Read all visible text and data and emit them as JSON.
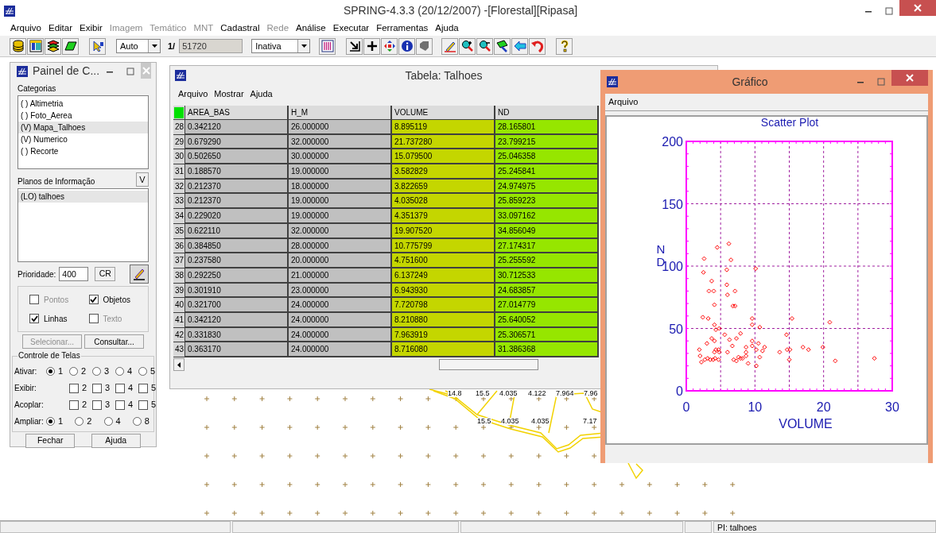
{
  "app_window": {
    "title": "SPRING-4.3.3 (20/12/2007) -[Florestal][Ripasa]"
  },
  "menu": [
    {
      "label": "Arquivo",
      "disabled": false
    },
    {
      "label": "Editar",
      "disabled": false
    },
    {
      "label": "Exibir",
      "disabled": false
    },
    {
      "label": "Imagem",
      "disabled": true
    },
    {
      "label": "Temático",
      "disabled": true
    },
    {
      "label": "MNT",
      "disabled": true
    },
    {
      "label": "Cadastral",
      "disabled": false
    },
    {
      "label": "Rede",
      "disabled": true
    },
    {
      "label": "Análise",
      "disabled": false
    },
    {
      "label": "Executar",
      "disabled": false
    },
    {
      "label": "Ferramentas",
      "disabled": false
    },
    {
      "label": "Ajuda",
      "disabled": false
    }
  ],
  "toolbar": {
    "scale_mode": "Auto",
    "scale_prefix": "1/",
    "scale": "51720",
    "display_mode": "Inativa"
  },
  "panel": {
    "title": "Painel de C...",
    "categories_label": "Categorias",
    "categories": [
      {
        "label": "( ) Altimetria",
        "selected": false
      },
      {
        "label": "( ) Foto_Aerea",
        "selected": false
      },
      {
        "label": "(V) Mapa_Talhoes",
        "selected": true
      },
      {
        "label": "(V) Numerico",
        "selected": false
      },
      {
        "label": "( ) Recorte",
        "selected": false
      }
    ],
    "planes_label": "Planos de Informação",
    "planes_button": "V",
    "planes": [
      {
        "label": "(LO) talhoes",
        "selected": true
      }
    ],
    "priority_label": "Prioridade:",
    "priority": "400",
    "cr_button": "CR",
    "draw_options": [
      {
        "label": "Pontos",
        "checked": false,
        "disabled": true
      },
      {
        "label": "Objetos",
        "checked": true,
        "disabled": false
      },
      {
        "label": "Linhas",
        "checked": true,
        "disabled": false
      },
      {
        "label": "Texto",
        "checked": false,
        "disabled": true
      }
    ],
    "buttons": [
      {
        "label": "Selecionar...",
        "disabled": true
      },
      {
        "label": "Consultar...",
        "disabled": false
      }
    ],
    "screens_group": "Controle de Telas",
    "screen_rows": [
      {
        "label": "Ativar:",
        "kind": "radio",
        "options": [
          {
            "label": "1",
            "selected": true
          },
          {
            "label": "2",
            "selected": false
          },
          {
            "label": "3",
            "selected": false
          },
          {
            "label": "4",
            "selected": false
          },
          {
            "label": "5",
            "selected": false
          }
        ]
      },
      {
        "label": "Exibir:",
        "kind": "checkbox",
        "options": [
          {
            "label": "2",
            "checked": false
          },
          {
            "label": "3",
            "checked": false
          },
          {
            "label": "4",
            "checked": false
          },
          {
            "label": "5",
            "checked": false
          }
        ]
      },
      {
        "label": "Acoplar:",
        "kind": "checkbox",
        "options": [
          {
            "label": "2",
            "checked": false
          },
          {
            "label": "3",
            "checked": false
          },
          {
            "label": "4",
            "checked": false
          },
          {
            "label": "5",
            "checked": false
          }
        ]
      },
      {
        "label": "Ampliar:",
        "kind": "radio",
        "options": [
          {
            "label": "1",
            "selected": true
          },
          {
            "label": "2",
            "selected": false
          },
          {
            "label": "4",
            "selected": false
          },
          {
            "label": "8",
            "selected": false
          }
        ]
      }
    ],
    "footer_buttons": [
      "Fechar",
      "Ajuda"
    ]
  },
  "table_window": {
    "title": "Tabela: Talhoes",
    "menu": [
      "Arquivo",
      "Mostrar",
      "Ajuda"
    ],
    "columns": [
      {
        "label": "AREA_BAS",
        "color": "#c0c0c0"
      },
      {
        "label": "H_M",
        "color": "#c0c0c0"
      },
      {
        "label": "VOLUME",
        "color": "#c4d600"
      },
      {
        "label": "ND",
        "color": "#96e600"
      }
    ],
    "rows": [
      {
        "number": "28",
        "cells": [
          "0.342120",
          "26.000000",
          "8.895119",
          "28.165801"
        ]
      },
      {
        "number": "29",
        "cells": [
          "0.679290",
          "32.000000",
          "21.737280",
          "23.799215"
        ]
      },
      {
        "number": "30",
        "cells": [
          "0.502650",
          "30.000000",
          "15.079500",
          "25.046358"
        ]
      },
      {
        "number": "31",
        "cells": [
          "0.188570",
          "19.000000",
          "3.582829",
          "25.245841"
        ]
      },
      {
        "number": "32",
        "cells": [
          "0.212370",
          "18.000000",
          "3.822659",
          "24.974975"
        ]
      },
      {
        "number": "33",
        "cells": [
          "0.212370",
          "19.000000",
          "4.035028",
          "25.859223"
        ]
      },
      {
        "number": "34",
        "cells": [
          "0.229020",
          "19.000000",
          "4.351379",
          "33.097162"
        ]
      },
      {
        "number": "35",
        "cells": [
          "0.622110",
          "32.000000",
          "19.907520",
          "34.856049"
        ]
      },
      {
        "number": "36",
        "cells": [
          "0.384850",
          "28.000000",
          "10.775799",
          "27.174317"
        ]
      },
      {
        "number": "37",
        "cells": [
          "0.237580",
          "20.000000",
          "4.751600",
          "25.255592"
        ]
      },
      {
        "number": "38",
        "cells": [
          "0.292250",
          "21.000000",
          "6.137249",
          "30.712533"
        ]
      },
      {
        "number": "39",
        "cells": [
          "0.301910",
          "23.000000",
          "6.943930",
          "24.683857"
        ]
      },
      {
        "number": "40",
        "cells": [
          "0.321700",
          "24.000000",
          "7.720798",
          "27.014779"
        ]
      },
      {
        "number": "41",
        "cells": [
          "0.342120",
          "24.000000",
          "8.210880",
          "25.640052"
        ]
      },
      {
        "number": "42",
        "cells": [
          "0.331830",
          "24.000000",
          "7.963919",
          "25.306571"
        ]
      },
      {
        "number": "43",
        "cells": [
          "0.363170",
          "24.000000",
          "8.716080",
          "31.386368"
        ]
      }
    ]
  },
  "chart_window": {
    "title": "Gráfico",
    "menu": [
      "Arquivo"
    ],
    "chart_data": {
      "type": "scatter",
      "title": "Scatter Plot",
      "xlabel": "VOLUME",
      "ylabel": "ND",
      "grid": true,
      "x": [
        2.6,
        2.5,
        4.5,
        6.2,
        6.5,
        5.9,
        10.1,
        3.7,
        3.3,
        4.0,
        5.9,
        6.0,
        7.1,
        4.1,
        6.8,
        7.1,
        2.4,
        3.2,
        9.6,
        15.4,
        20.9,
        4.1,
        9.6,
        10.7,
        4.8,
        4.3,
        5.6,
        7.9,
        14.6,
        3.7,
        7.3,
        3.0,
        4.1,
        6.3,
        9.6,
        10.5,
        9.6,
        6.7,
        8.7,
        11.4,
        17.0,
        19.9,
        1.9,
        4.3,
        4.7,
        10.2,
        11.1,
        14.7,
        15.1,
        17.8,
        8.7,
        4.1,
        4.8,
        6.0,
        13.6,
        2.0,
        8.7,
        10.7,
        7.6,
        2.7,
        3.1,
        3.5,
        3.9,
        4.2,
        4.7,
        6.9,
        7.3,
        7.9,
        8.2,
        15.0,
        27.4,
        2.2,
        9.0,
        10.2,
        21.7
      ],
      "series": [
        {
          "color": "#ff0000",
          "values": [
            106,
            95,
            115,
            118,
            105,
            97,
            98,
            88,
            80,
            80,
            85,
            77,
            80,
            69,
            68,
            68,
            59,
            58,
            58,
            58,
            55,
            53,
            53,
            51,
            50,
            49,
            45,
            46,
            45,
            42,
            42,
            38,
            40,
            41,
            40,
            38,
            36,
            36,
            35,
            35,
            35,
            35,
            33,
            33,
            33,
            33,
            32,
            33,
            33,
            33,
            31,
            31,
            31,
            31,
            31,
            28,
            28,
            27,
            27,
            25,
            26,
            25,
            25,
            26,
            25,
            25,
            24,
            26,
            26,
            25,
            26,
            23,
            22,
            20,
            24
          ]
        }
      ],
      "xlim": [
        0,
        30
      ],
      "ylim": [
        0,
        200
      ],
      "xticks": [
        0,
        10,
        20,
        30
      ],
      "yticks": [
        0,
        50,
        100,
        150,
        200
      ]
    }
  },
  "map": {
    "labels": [
      "14.8",
      "15.5",
      "4.035",
      "4.122",
      "7.964",
      "7.96",
      "15.5",
      "4.035",
      "4.035",
      "7.17"
    ]
  },
  "status_bar": {
    "layer": "PI: talhoes"
  }
}
